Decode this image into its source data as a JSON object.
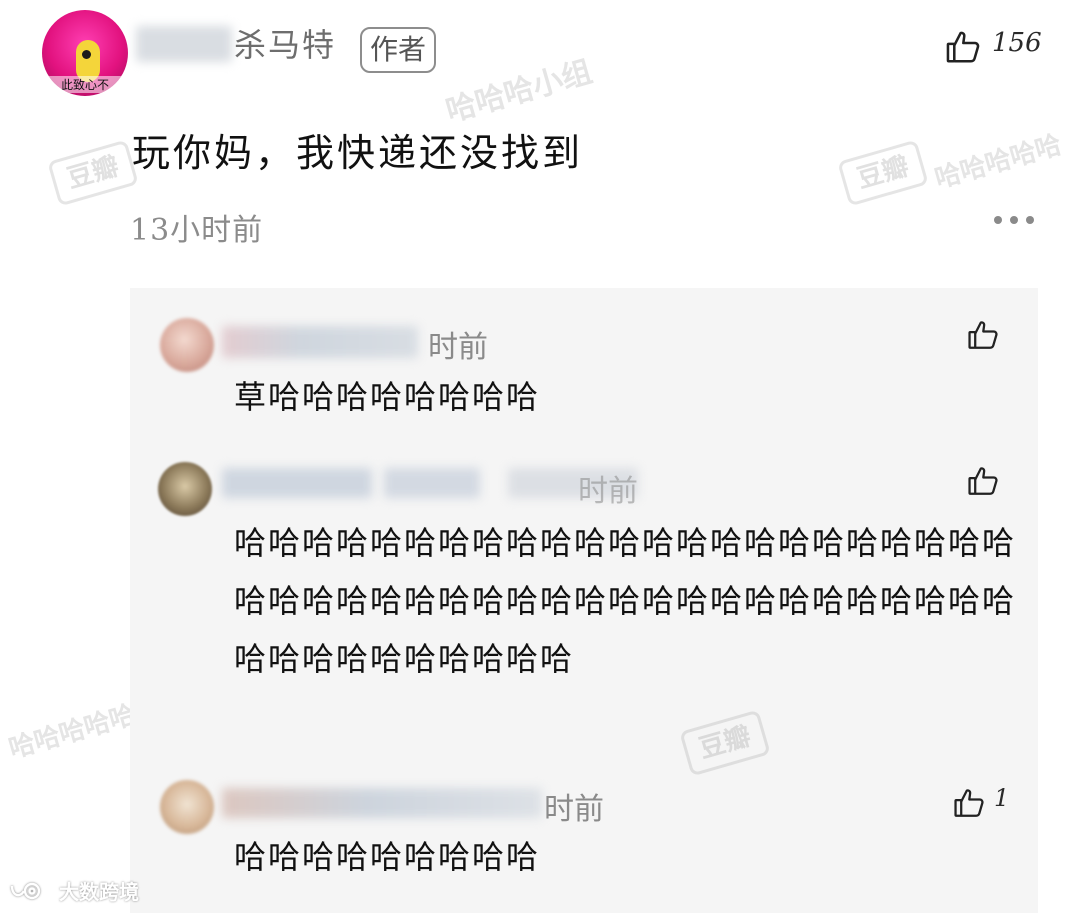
{
  "comment": {
    "avatar_caption": "此致心不",
    "author_name": "杀马特",
    "author_tag": "作者",
    "like_count": "156",
    "text": "玩你妈，我快递还没找到",
    "time": "13小时前"
  },
  "replies": [
    {
      "time": "时前",
      "text": "草哈哈哈哈哈哈哈哈",
      "like_count": ""
    },
    {
      "time": "时前",
      "text": "哈哈哈哈哈哈哈哈哈哈哈哈哈哈哈哈哈哈哈哈哈哈哈哈哈哈哈哈哈哈哈哈哈哈哈哈哈哈哈哈哈哈哈哈哈哈哈哈哈哈哈哈哈哈哈哈",
      "like_count": ""
    },
    {
      "time": "时前",
      "text": "哈哈哈哈哈哈哈哈哈",
      "like_count": "1"
    }
  ],
  "watermarks": {
    "group_text": "哈哈哈小组",
    "logo_text": "豆瓣",
    "repeat_text": "哈哈哈哈哈",
    "brand": "大数跨境"
  },
  "icons": {
    "like": "thumbs-up-icon",
    "more": "more-dots-icon",
    "brand": "brand-logo-icon"
  },
  "colors": {
    "panel_bg": "#f5f5f5",
    "author_tag_border": "#8d8d8d",
    "muted_text": "#8a8a8a",
    "avatar_pink": "#e2127f"
  }
}
